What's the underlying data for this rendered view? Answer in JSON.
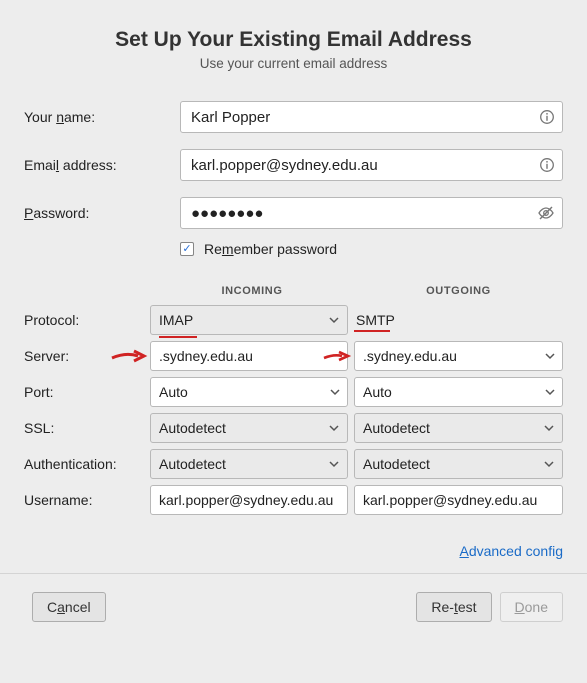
{
  "header": {
    "title": "Set Up Your Existing Email Address",
    "subtitle": "Use your current email address"
  },
  "fields": {
    "name_label_pre": "Your ",
    "name_label_u": "n",
    "name_label_post": "ame:",
    "name_value": "Karl Popper",
    "email_label_pre": "Emai",
    "email_label_u": "l",
    "email_label_post": " address:",
    "email_value": "karl.popper@sydney.edu.au",
    "pass_label_u": "P",
    "pass_label_post": "assword:",
    "pass_value": "●●●●●●●●",
    "remember_pre": "Re",
    "remember_u": "m",
    "remember_post": "ember password",
    "remember_checked": true
  },
  "server": {
    "head_incoming": "INCOMING",
    "head_outgoing": "OUTGOING",
    "label_protocol": "Protocol:",
    "label_server": "Server:",
    "label_port": "Port:",
    "label_ssl": "SSL:",
    "label_auth": "Authentication:",
    "label_user": "Username:",
    "in_protocol": "IMAP",
    "out_protocol": "SMTP",
    "in_server": ".sydney.edu.au",
    "out_server": ".sydney.edu.au",
    "in_port": "Auto",
    "out_port": "Auto",
    "in_ssl": "Autodetect",
    "out_ssl": "Autodetect",
    "in_auth": "Autodetect",
    "out_auth": "Autodetect",
    "in_user": "karl.popper@sydney.edu.au",
    "out_user": "karl.popper@sydney.edu.au"
  },
  "links": {
    "adv_u": "A",
    "adv_post": "dvanced config"
  },
  "buttons": {
    "cancel_pre": "C",
    "cancel_u": "a",
    "cancel_post": "ncel",
    "retest_pre": "Re-",
    "retest_u": "t",
    "retest_post": "est",
    "done_u": "D",
    "done_post": "one"
  },
  "icons": {
    "info": "info-icon",
    "eye": "eye-off-icon",
    "chev": "chevron-down-icon",
    "check": "check-icon"
  }
}
